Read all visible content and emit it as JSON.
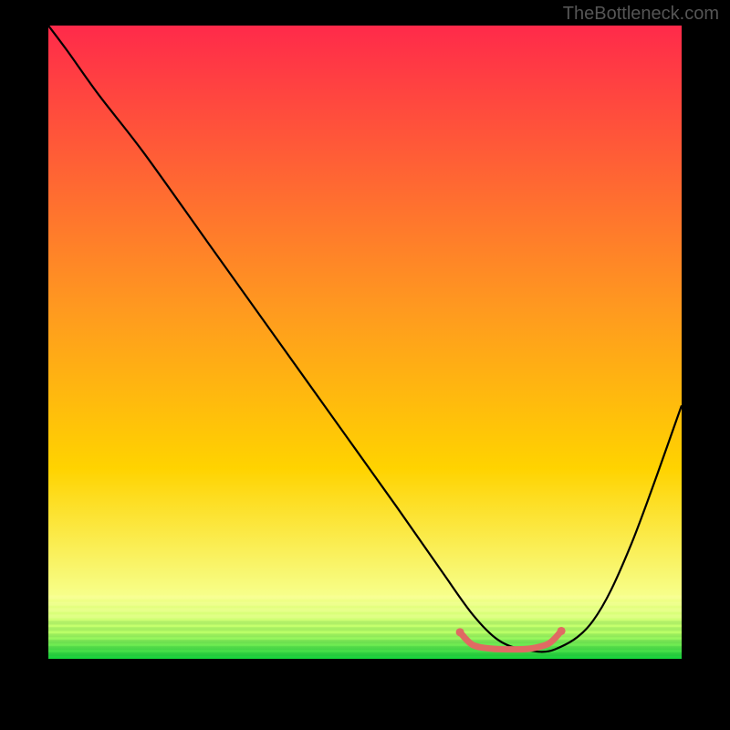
{
  "watermark": "TheBottleneck.com",
  "chart_data": {
    "type": "line",
    "title": "",
    "xlabel": "",
    "ylabel": "",
    "xlim": [
      0,
      100
    ],
    "ylim": [
      0,
      100
    ],
    "background_gradient": {
      "top": "#ff2a4a",
      "mid": "#ffd300",
      "bottom_band": "#f7ff8a",
      "base": "#12d13a"
    },
    "series": [
      {
        "name": "bottleneck-curve",
        "color": "#000000",
        "x": [
          0,
          3,
          8,
          15,
          25,
          35,
          45,
          55,
          62,
          67,
          71,
          75,
          80,
          86,
          92,
          100
        ],
        "y": [
          100,
          96,
          89,
          80,
          66,
          52,
          38,
          24,
          14,
          7,
          3,
          1.5,
          1.5,
          6,
          18,
          40
        ]
      }
    ],
    "highlight": {
      "name": "optimal-range",
      "color": "#e06a63",
      "x": [
        65,
        67,
        70,
        73,
        76,
        79,
        81
      ],
      "y": [
        4.2,
        2.2,
        1.6,
        1.5,
        1.6,
        2.4,
        4.4
      ]
    }
  }
}
